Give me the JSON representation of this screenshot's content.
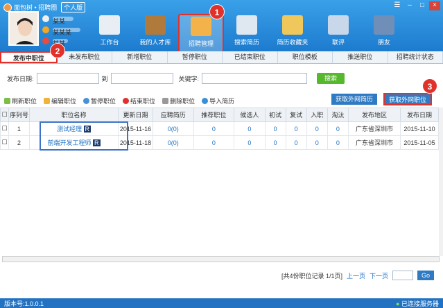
{
  "app": {
    "title": "面包树 • 招聘圈",
    "edition": "个人版",
    "colors": {
      "titlebar": "#2a86d8",
      "highlight": "#e0322b",
      "link": "#1a6fc4"
    }
  },
  "user": {
    "name": "某某",
    "contact": "某某某",
    "score": "某某"
  },
  "nav": [
    {
      "label": "工作台",
      "icon": "monitor-icon"
    },
    {
      "label": "我的人才库",
      "icon": "briefcase-icon"
    },
    {
      "label": "招聘管理",
      "icon": "clipboard-icon"
    },
    {
      "label": "搜索简历",
      "icon": "magnifier-icon"
    },
    {
      "label": "简历收藏夹",
      "icon": "folder-icon"
    },
    {
      "label": "联评",
      "icon": "compass-icon"
    },
    {
      "label": "朋友",
      "icon": "person-icon"
    }
  ],
  "badges": [
    "1",
    "2",
    "3"
  ],
  "tabs": [
    "发布中职位",
    "未发布职位",
    "新增职位",
    "暂停职位",
    "已结束职位",
    "职位模板",
    "推送职位",
    "招聘统计状态"
  ],
  "search": {
    "date_label": "发布日期:",
    "to_label": "到",
    "keyword_label": "关键字:",
    "button": "搜索"
  },
  "toolbar": [
    "刷新职位",
    "编辑职位",
    "暂停职位",
    "结束职位",
    "删除职位",
    "导入简历"
  ],
  "right_buttons": [
    "获取外网简历",
    "获取外网职位"
  ],
  "table": {
    "headers": [
      "序列号",
      "职位名称",
      "更新日期",
      "应聘简历",
      "推荐职位",
      "候选人",
      "初试",
      "复试",
      "入职",
      "淘汰",
      "发布地区",
      "发布日期"
    ],
    "rows": [
      [
        "1",
        "测试经理",
        "2015-11-16",
        "0(0)",
        "0",
        "0",
        "0",
        "0",
        "0",
        "0",
        "广东省深圳市",
        "2015-11-10"
      ],
      [
        "2",
        "前端开发工程师",
        "2015-11-18",
        "0(0)",
        "0",
        "0",
        "0",
        "0",
        "0",
        "0",
        "广东省深圳市",
        "2015-11-05"
      ]
    ]
  },
  "pagination": {
    "summary": "[共4份职位记录 1/1页]",
    "prev": "上一页",
    "next": "下一页",
    "go": "Go"
  },
  "status": {
    "version": "版本号:1.0.0.1",
    "connection": "已连接服务器"
  }
}
